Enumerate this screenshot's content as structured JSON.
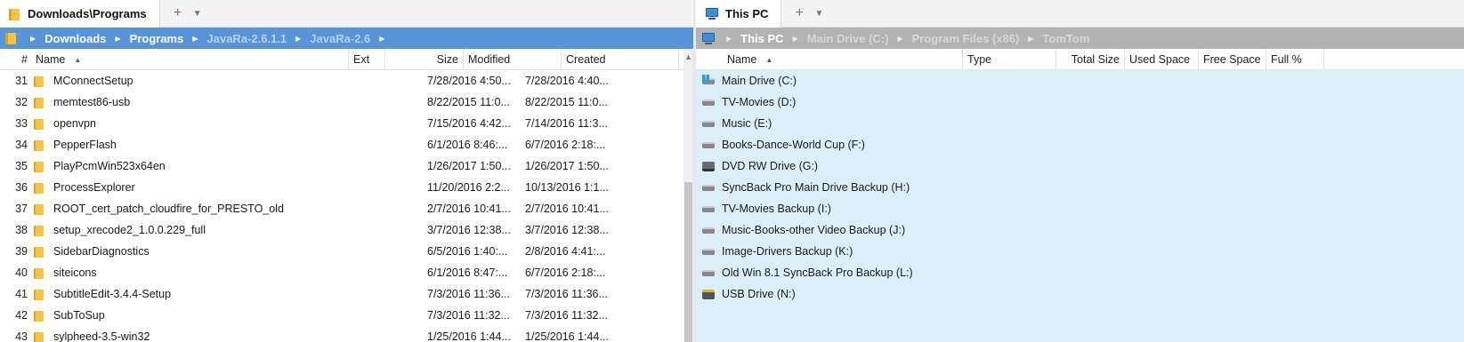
{
  "left": {
    "tab_title": "Downloads\\Programs",
    "tab_add": "+",
    "tab_menu": "▼",
    "breadcrumb": [
      "Downloads",
      "Programs",
      "JavaRa-2.6.1.1",
      "JavaRa-2.6"
    ],
    "columns": {
      "num": "#",
      "name": "Name",
      "ext": "Ext",
      "size": "Size",
      "modified": "Modified",
      "created": "Created"
    },
    "rows": [
      {
        "num": "31",
        "name": "MConnectSetup",
        "modified": "7/28/2016 4:50...",
        "created": "7/28/2016 4:40..."
      },
      {
        "num": "32",
        "name": "memtest86-usb",
        "modified": "8/22/2015 11:0...",
        "created": "8/22/2015 11:0..."
      },
      {
        "num": "33",
        "name": "openvpn",
        "modified": "7/15/2016 4:42...",
        "created": "7/14/2016 11:3..."
      },
      {
        "num": "34",
        "name": "PepperFlash",
        "modified": "6/1/2016 8:46:...",
        "created": "6/7/2016 2:18:..."
      },
      {
        "num": "35",
        "name": "PlayPcmWin523x64en",
        "modified": "1/26/2017 1:50...",
        "created": "1/26/2017 1:50..."
      },
      {
        "num": "36",
        "name": "ProcessExplorer",
        "modified": "11/20/2016 2:2...",
        "created": "10/13/2016 1:1..."
      },
      {
        "num": "37",
        "name": "ROOT_cert_patch_cloudfire_for_PRESTO_old",
        "modified": "2/7/2016 10:41...",
        "created": "2/7/2016 10:41..."
      },
      {
        "num": "38",
        "name": "setup_xrecode2_1.0.0.229_full",
        "modified": "3/7/2016 12:38...",
        "created": "3/7/2016 12:38..."
      },
      {
        "num": "39",
        "name": "SidebarDiagnostics",
        "modified": "6/5/2016 1:40:...",
        "created": "2/8/2016 4:41:..."
      },
      {
        "num": "40",
        "name": "siteicons",
        "modified": "6/1/2016 8:47:...",
        "created": "6/7/2016 2:18:..."
      },
      {
        "num": "41",
        "name": "SubtitleEdit-3.4.4-Setup",
        "modified": "7/3/2016 11:36...",
        "created": "7/3/2016 11:36..."
      },
      {
        "num": "42",
        "name": "SubToSup",
        "modified": "7/3/2016 11:32...",
        "created": "7/3/2016 11:32..."
      },
      {
        "num": "43",
        "name": "sylpheed-3.5-win32",
        "modified": "1/25/2016 1:44...",
        "created": "1/25/2016 1:44..."
      }
    ]
  },
  "right": {
    "tab_title": "This PC",
    "tab_add": "+",
    "tab_menu": "▼",
    "breadcrumb": [
      "This PC",
      "Main Drive (C:)",
      "Program Files (x86)",
      "TomTom"
    ],
    "columns": {
      "name": "Name",
      "type": "Type",
      "total": "Total Size",
      "used": "Used Space",
      "free": "Free Space",
      "full": "Full %"
    },
    "drives": [
      {
        "name": "Main Drive (C:)",
        "icon": "windows-drive-icon"
      },
      {
        "name": "TV-Movies (D:)",
        "icon": "hard-drive-icon"
      },
      {
        "name": "Music (E:)",
        "icon": "hard-drive-icon"
      },
      {
        "name": "Books-Dance-World Cup (F:)",
        "icon": "hard-drive-icon"
      },
      {
        "name": "DVD RW Drive (G:)",
        "icon": "dvd-drive-icon"
      },
      {
        "name": "SyncBack Pro Main Drive Backup (H:)",
        "icon": "hard-drive-icon"
      },
      {
        "name": "TV-Movies Backup (I:)",
        "icon": "hard-drive-icon"
      },
      {
        "name": "Music-Books-other Video Backup (J:)",
        "icon": "hard-drive-icon"
      },
      {
        "name": "Image-Drivers Backup (K:)",
        "icon": "hard-drive-icon"
      },
      {
        "name": "Old Win 8.1 SyncBack Pro Backup (L:)",
        "icon": "hard-drive-icon"
      },
      {
        "name": "USB Drive (N:)",
        "icon": "usb-drive-icon"
      }
    ]
  },
  "colors": {
    "left_crumb_bg": "#5794d8",
    "right_crumb_bg": "#b3b3b3",
    "right_pane_bg": "#dbeffb",
    "folder": "#f4c443"
  }
}
